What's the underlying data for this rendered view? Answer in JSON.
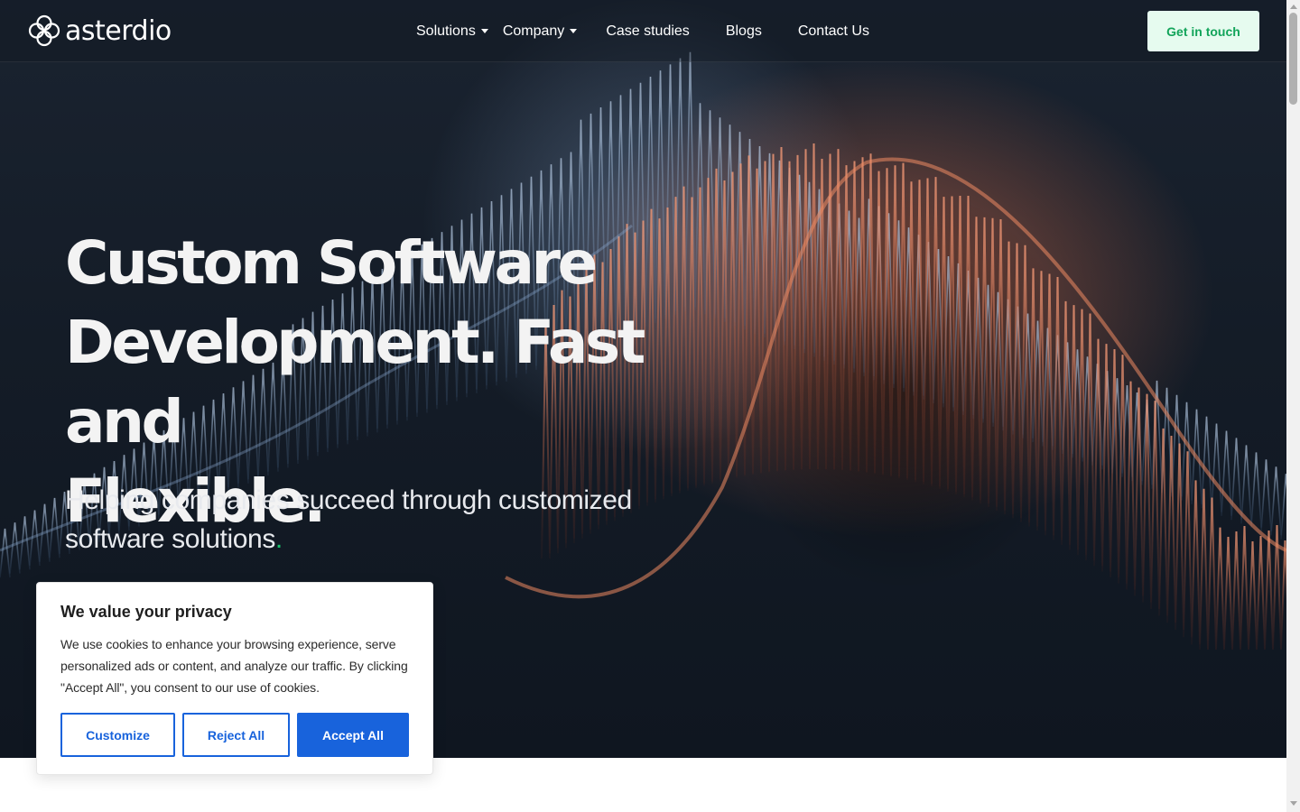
{
  "brand": {
    "name": "asterdio",
    "logo_icon": "clover-logo-icon"
  },
  "nav": {
    "items": [
      {
        "label": "Solutions",
        "dropdown": true
      },
      {
        "label": "Company",
        "dropdown": true
      },
      {
        "label": "Case studies",
        "dropdown": false
      },
      {
        "label": "Blogs",
        "dropdown": false
      },
      {
        "label": "Contact Us",
        "dropdown": false
      }
    ],
    "cta_label": "Get in touch"
  },
  "hero": {
    "headline_line1": "Custom Software",
    "headline_line2": "Development. Fast and",
    "headline_line3": "Flexible.",
    "subheadline": "Helping companies succeed through customized software solutions",
    "subheadline_end": "."
  },
  "cookie_banner": {
    "title": "We value your privacy",
    "text": "We use cookies to enhance your browsing experience, serve personalized ads or content, and analyze our traffic. By clicking \"Accept All\", you consent to our use of cookies.",
    "customize_label": "Customize",
    "reject_label": "Reject All",
    "accept_label": "Accept All"
  },
  "colors": {
    "hero_bg": "#141c27",
    "accent_green": "#16c36c",
    "cta_bg": "#e6fbef",
    "cookie_blue": "#1863dc"
  }
}
